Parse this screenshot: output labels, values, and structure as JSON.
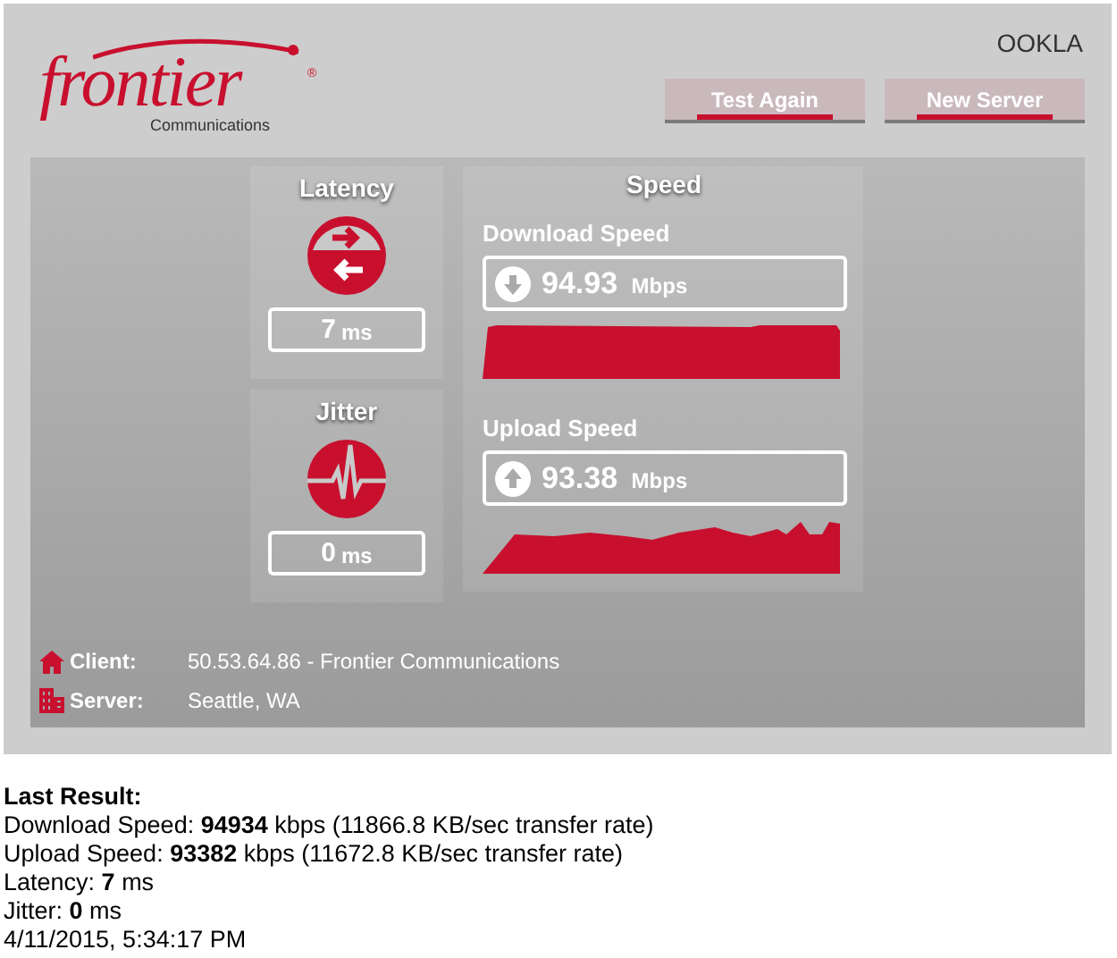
{
  "header": {
    "logo": {
      "name": "frontier",
      "mark": "®",
      "tagline": "Communications"
    },
    "partner_logo": "OOKLA",
    "buttons": [
      {
        "label": "Test Again"
      },
      {
        "label": "New Server"
      }
    ]
  },
  "latency": {
    "title": "Latency",
    "value": "7",
    "unit": "ms"
  },
  "jitter": {
    "title": "Jitter",
    "value": "0",
    "unit": "ms"
  },
  "speed": {
    "title": "Speed",
    "tests": [
      {
        "kind": "download",
        "title": "Download Speed",
        "value": "94.93",
        "unit": "Mbps"
      },
      {
        "kind": "upload",
        "title": "Upload Speed",
        "value": "93.38",
        "unit": "Mbps"
      }
    ]
  },
  "info": [
    {
      "kind": "client",
      "label": "Client:",
      "value": "50.53.64.86 - Frontier Communications"
    },
    {
      "kind": "server",
      "label": "Server:",
      "value": "Seattle, WA"
    }
  ],
  "last_result": {
    "title": "Last Result:",
    "lines": [
      "Download Speed: **94934** kbps (11866.8 KB/sec transfer rate)",
      "Upload Speed: **93382** kbps (11672.8 KB/sec transfer rate)",
      "Latency: **7** ms",
      "Jitter: **0** ms",
      "4/11/2015, 5:34:17 PM"
    ]
  }
}
